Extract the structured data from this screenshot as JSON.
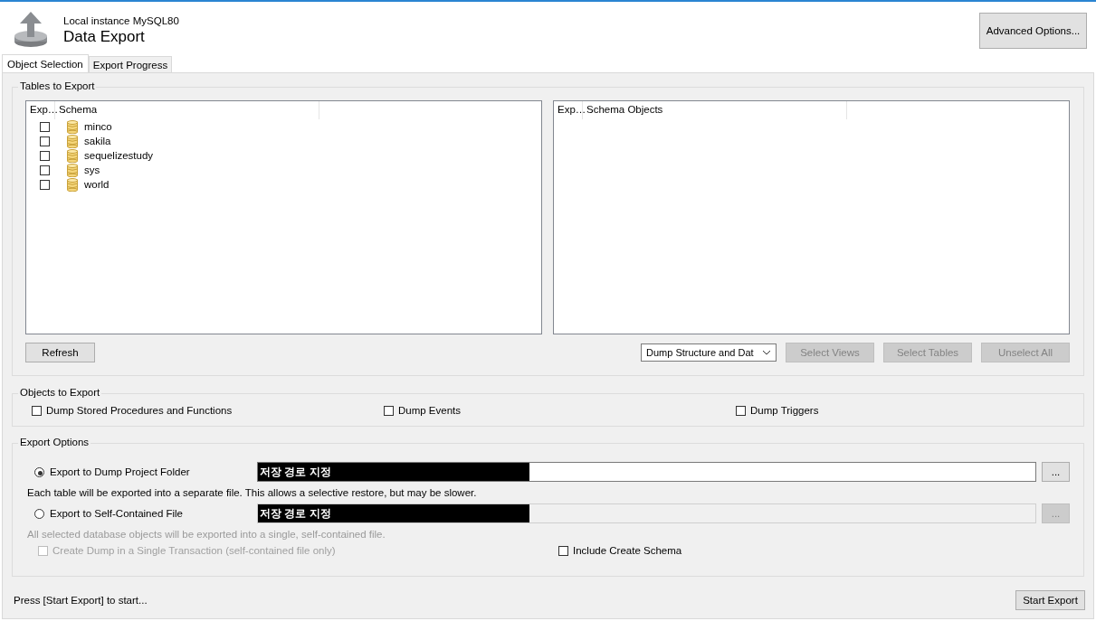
{
  "header": {
    "subtitle": "Local instance MySQL80",
    "title": "Data Export",
    "advanced_button": "Advanced Options..."
  },
  "tabs": [
    {
      "label": "Object Selection",
      "selected": true
    },
    {
      "label": "Export Progress",
      "selected": false
    }
  ],
  "tables_to_export": {
    "title": "Tables to Export",
    "schema_list": {
      "columns": [
        "Exp…",
        "Schema"
      ],
      "rows": [
        {
          "name": "minco",
          "checked": false
        },
        {
          "name": "sakila",
          "checked": false
        },
        {
          "name": "sequelizestudy",
          "checked": false
        },
        {
          "name": "sys",
          "checked": false
        },
        {
          "name": "world",
          "checked": false
        }
      ]
    },
    "objects_list": {
      "columns": [
        "Exp…",
        "Schema Objects"
      ]
    },
    "refresh_button": "Refresh",
    "dump_mode": "Dump Structure and Dat",
    "buttons": [
      {
        "label": "Select Views",
        "disabled": true
      },
      {
        "label": "Select Tables",
        "disabled": true
      },
      {
        "label": "Unselect All",
        "disabled": true
      }
    ]
  },
  "objects_to_export": {
    "title": "Objects to Export",
    "options": [
      {
        "label": "Dump Stored Procedures and Functions",
        "checked": false
      },
      {
        "label": "Dump Events",
        "checked": false
      },
      {
        "label": "Dump Triggers",
        "checked": false
      }
    ]
  },
  "export_options": {
    "title": "Export Options",
    "targets": [
      {
        "label": "Export to Dump Project Folder",
        "selected": true,
        "redaction": "저장 경로 지정",
        "browse": "...",
        "disabled": false,
        "note": "Each table will be exported into a separate file. This allows a selective restore, but may be slower."
      },
      {
        "label": "Export to Self-Contained File",
        "selected": false,
        "redaction": "저장 경로 지정",
        "browse": "...",
        "disabled": true,
        "note": "All selected database objects will be exported into a single, self-contained file."
      }
    ],
    "extras": [
      {
        "label": "Create Dump in a Single Transaction (self-contained file only)",
        "checked": false,
        "disabled": true
      },
      {
        "label": "Include Create Schema",
        "checked": false,
        "disabled": false
      }
    ]
  },
  "status": "Press [Start Export] to start...",
  "start_button": "Start Export"
}
